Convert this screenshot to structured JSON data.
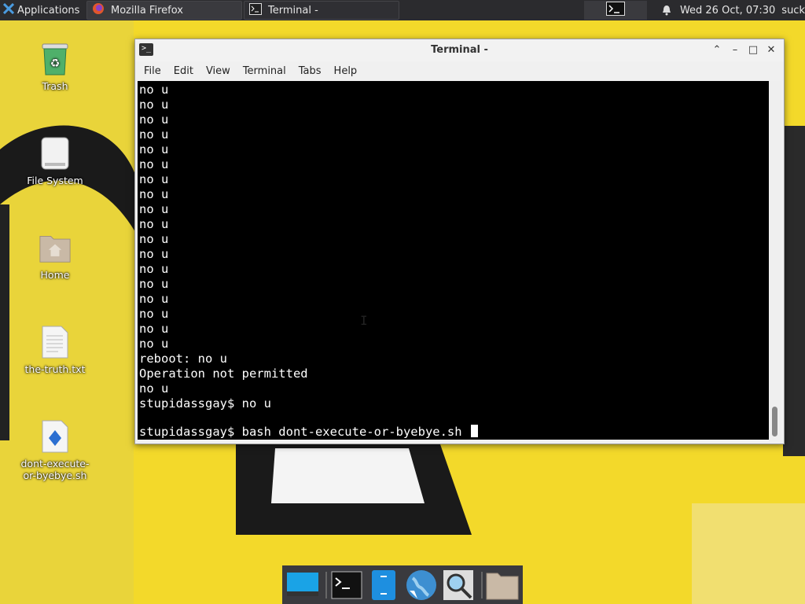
{
  "top_panel": {
    "applications_label": "Applications",
    "tasks": [
      {
        "label": "Mozilla Firefox",
        "icon": "firefox-icon"
      },
      {
        "label": "Terminal -",
        "icon": "terminal-icon"
      }
    ],
    "clock": "Wed 26 Oct, 07:30",
    "user": "suck"
  },
  "desktop": {
    "icons": [
      {
        "label": "Trash",
        "icon": "trash-icon"
      },
      {
        "label": "File System",
        "icon": "drive-icon"
      },
      {
        "label": "Home",
        "icon": "home-folder-icon"
      },
      {
        "label": "the-truth.txt",
        "icon": "text-file-icon"
      },
      {
        "label": "dont-execute-or-byebye.sh",
        "icon": "script-file-icon"
      }
    ]
  },
  "terminal": {
    "title": "Terminal -",
    "menu": [
      "File",
      "Edit",
      "View",
      "Terminal",
      "Tabs",
      "Help"
    ],
    "output_lines": [
      "no u",
      "no u",
      "no u",
      "no u",
      "no u",
      "no u",
      "no u",
      "no u",
      "no u",
      "no u",
      "no u",
      "no u",
      "no u",
      "no u",
      "no u",
      "no u",
      "no u",
      "no u",
      "reboot: no u",
      "Operation not permitted",
      "no u",
      "stupidassgay$ no u",
      ""
    ],
    "prompt_line": "stupidassgay$ bash dont-execute-or-byebye.sh "
  },
  "dock": {
    "items": [
      "show-desktop-icon",
      "terminal-icon",
      "file-manager-icon",
      "web-browser-icon",
      "app-finder-icon",
      "folder-icon"
    ]
  },
  "colors": {
    "panel_bg": "#2b2b2e",
    "wallpaper_yellow": "#f3d92a",
    "terminal_bg": "#000000",
    "terminal_fg": "#ffffff"
  }
}
